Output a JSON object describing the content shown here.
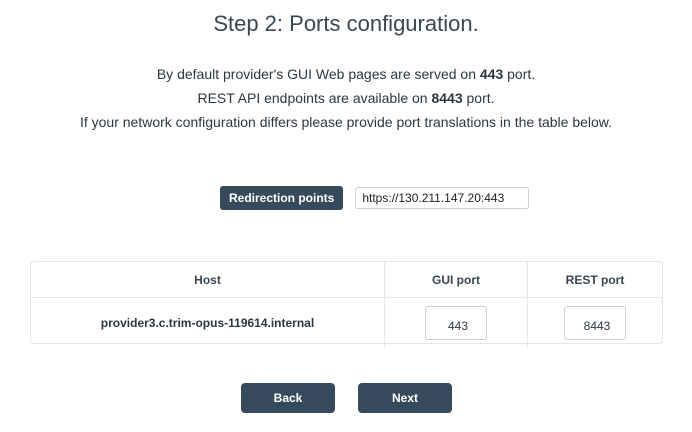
{
  "page": {
    "title": "Step 2: Ports configuration."
  },
  "description": {
    "line1_prefix": "By default provider's GUI Web pages are served on ",
    "line1_value": "443",
    "line1_suffix": " port.",
    "line2_prefix": "REST API endpoints are available on ",
    "line2_value": "8443",
    "line2_suffix": " port.",
    "line3": "If your network configuration differs please provide port translations in the table below."
  },
  "redirection": {
    "label": "Redirection points",
    "value": "https://130.211.147.20:443"
  },
  "table": {
    "headers": {
      "host": "Host",
      "gui_port": "GUI port",
      "rest_port": "REST port"
    },
    "rows": [
      {
        "host": "provider3.c.trim-opus-119614.internal",
        "gui_port": "443",
        "rest_port": "8443"
      }
    ]
  },
  "actions": {
    "back_label": "Back",
    "next_label": "Next"
  },
  "colors": {
    "button_bg": "#374a5c",
    "border": "#e3e6ea"
  }
}
